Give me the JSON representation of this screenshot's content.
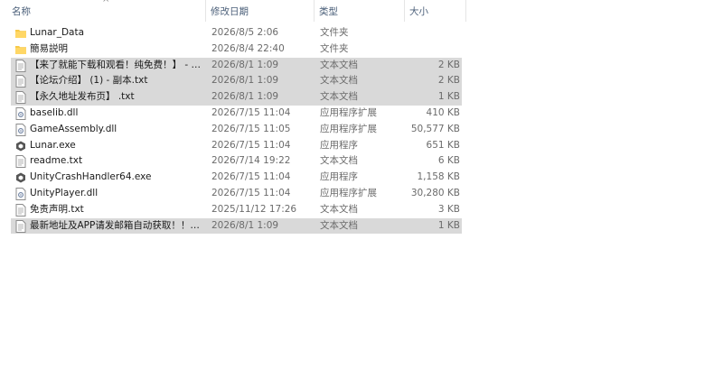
{
  "columns": {
    "name": "名称",
    "date": "修改日期",
    "type": "类型",
    "size": "大小"
  },
  "sort_indicator": "^",
  "files": [
    {
      "icon": "folder-icon",
      "name": "Lunar_Data",
      "date": "2026/8/5 2:06",
      "type": "文件夹",
      "size": "",
      "selected": false
    },
    {
      "icon": "folder-icon",
      "name": "簡易説明",
      "date": "2026/8/4 22:40",
      "type": "文件夹",
      "size": "",
      "selected": false
    },
    {
      "icon": "text-file-icon",
      "name": "【来了就能下载和观看！纯免费！】 - 副...",
      "date": "2026/8/1 1:09",
      "type": "文本文档",
      "size": "2 KB",
      "selected": true
    },
    {
      "icon": "text-file-icon",
      "name": "【论坛介绍】 (1) - 副本.txt",
      "date": "2026/8/1 1:09",
      "type": "文本文档",
      "size": "2 KB",
      "selected": true
    },
    {
      "icon": "text-file-icon",
      "name": "【永久地址发布页】 .txt",
      "date": "2026/8/1 1:09",
      "type": "文本文档",
      "size": "1 KB",
      "selected": true
    },
    {
      "icon": "dll-file-icon",
      "name": "baselib.dll",
      "date": "2026/7/15 11:04",
      "type": "应用程序扩展",
      "size": "410 KB",
      "selected": false
    },
    {
      "icon": "dll-file-icon",
      "name": "GameAssembly.dll",
      "date": "2026/7/15 11:05",
      "type": "应用程序扩展",
      "size": "50,577 KB",
      "selected": false
    },
    {
      "icon": "unity-exe-icon",
      "name": "Lunar.exe",
      "date": "2026/7/15 11:04",
      "type": "应用程序",
      "size": "651 KB",
      "selected": false
    },
    {
      "icon": "text-file-icon",
      "name": "readme.txt",
      "date": "2026/7/14 19:22",
      "type": "文本文档",
      "size": "6 KB",
      "selected": false
    },
    {
      "icon": "unity-exe-icon",
      "name": "UnityCrashHandler64.exe",
      "date": "2026/7/15 11:04",
      "type": "应用程序",
      "size": "1,158 KB",
      "selected": false
    },
    {
      "icon": "dll-file-icon",
      "name": "UnityPlayer.dll",
      "date": "2026/7/15 11:04",
      "type": "应用程序扩展",
      "size": "30,280 KB",
      "selected": false
    },
    {
      "icon": "text-file-icon",
      "name": "免责声明.txt",
      "date": "2025/11/12 17:26",
      "type": "文本文档",
      "size": "3 KB",
      "selected": false
    },
    {
      "icon": "text-file-icon",
      "name": "最新地址及APP请发邮箱自动获取！！！...",
      "date": "2026/8/1 1:09",
      "type": "文本文档",
      "size": "1 KB",
      "selected": true
    }
  ]
}
